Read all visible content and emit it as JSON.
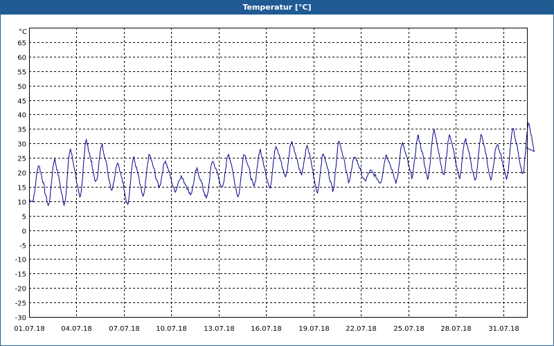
{
  "window": {
    "title": "Temperatur [°C]"
  },
  "chart_data": {
    "type": "line",
    "title": "Temperatur [°C]",
    "ylabel": "°C",
    "xlabel": "",
    "ylim": [
      -30,
      70
    ],
    "yticks": [
      65,
      60,
      55,
      50,
      45,
      40,
      35,
      30,
      25,
      20,
      15,
      10,
      5,
      0,
      -5,
      -10,
      -15,
      -20,
      -25,
      -30
    ],
    "xlim_days": [
      0,
      31.5
    ],
    "xticks": [
      {
        "day": 0,
        "label": "01.07.18"
      },
      {
        "day": 3,
        "label": "04.07.18"
      },
      {
        "day": 6,
        "label": "07.07.18"
      },
      {
        "day": 9,
        "label": "10.07.18"
      },
      {
        "day": 12,
        "label": "13.07.18"
      },
      {
        "day": 15,
        "label": "16.07.18"
      },
      {
        "day": 18,
        "label": "19.07.18"
      },
      {
        "day": 21,
        "label": "22.07.18"
      },
      {
        "day": 24,
        "label": "25.07.18"
      },
      {
        "day": 27,
        "label": "28.07.18"
      },
      {
        "day": 30,
        "label": "31.07.18"
      }
    ],
    "grid": true,
    "line_color": "#00008b",
    "series": [
      {
        "daily_extremes": [
          {
            "min": 10,
            "max": 22.5
          },
          {
            "min": 8.5,
            "max": 24.5
          },
          {
            "min": 9,
            "max": 28
          },
          {
            "min": 11,
            "max": 31
          },
          {
            "min": 16.5,
            "max": 29.5
          },
          {
            "min": 14,
            "max": 23.5
          },
          {
            "min": 9,
            "max": 25
          },
          {
            "min": 11.5,
            "max": 26
          },
          {
            "min": 15,
            "max": 24
          },
          {
            "min": 13.5,
            "max": 18.5
          },
          {
            "min": 12.5,
            "max": 21
          },
          {
            "min": 11,
            "max": 24
          },
          {
            "min": 14.5,
            "max": 26.5
          },
          {
            "min": 11.5,
            "max": 26.5
          },
          {
            "min": 15,
            "max": 27.5
          },
          {
            "min": 14.5,
            "max": 29
          },
          {
            "min": 18.5,
            "max": 30.5
          },
          {
            "min": 19.5,
            "max": 29
          },
          {
            "min": 13,
            "max": 26.5
          },
          {
            "min": 14,
            "max": 31
          },
          {
            "min": 17,
            "max": 25.5
          },
          {
            "min": 17,
            "max": 20.5
          },
          {
            "min": 16.5,
            "max": 26
          },
          {
            "min": 16.5,
            "max": 30
          },
          {
            "min": 18.5,
            "max": 32.5
          },
          {
            "min": 18,
            "max": 34.5
          },
          {
            "min": 19,
            "max": 33
          },
          {
            "min": 18,
            "max": 31.5
          },
          {
            "min": 17,
            "max": 33
          },
          {
            "min": 17.5,
            "max": 30
          },
          {
            "min": 18,
            "max": 35.5
          },
          {
            "min": 19,
            "max": 37
          }
        ]
      }
    ]
  }
}
